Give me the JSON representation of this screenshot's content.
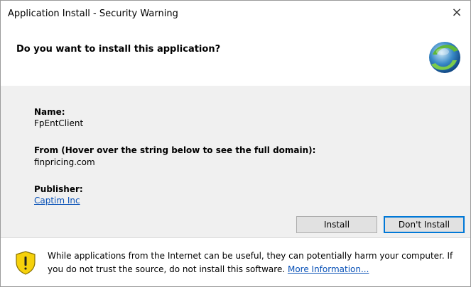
{
  "window": {
    "title": "Application Install - Security Warning",
    "close_symbol": "×"
  },
  "header": {
    "question": "Do you want to install this application?",
    "icon": "clickonce-globe-icon"
  },
  "details": {
    "name_label": "Name:",
    "name_value": "FpEntClient",
    "from_label": "From (Hover over the string below to see the full domain):",
    "from_value": "finpricing.com",
    "publisher_label": "Publisher:",
    "publisher_value": "Captim Inc"
  },
  "buttons": {
    "install_label": "Install",
    "dont_install_label": "Don't Install"
  },
  "footer": {
    "icon": "security-shield-warning-icon",
    "warning_line1": "While applications from the Internet can be useful, they can potentially harm your computer. If",
    "warning_line2_prefix": "you do not trust the source, do not install this software.",
    "more_info_link": "More Information..."
  },
  "colors": {
    "link": "#0a52b7",
    "content_background": "#f0f0f0",
    "default_button_border": "#0078d7",
    "shield_yellow": "#f6d10b"
  }
}
